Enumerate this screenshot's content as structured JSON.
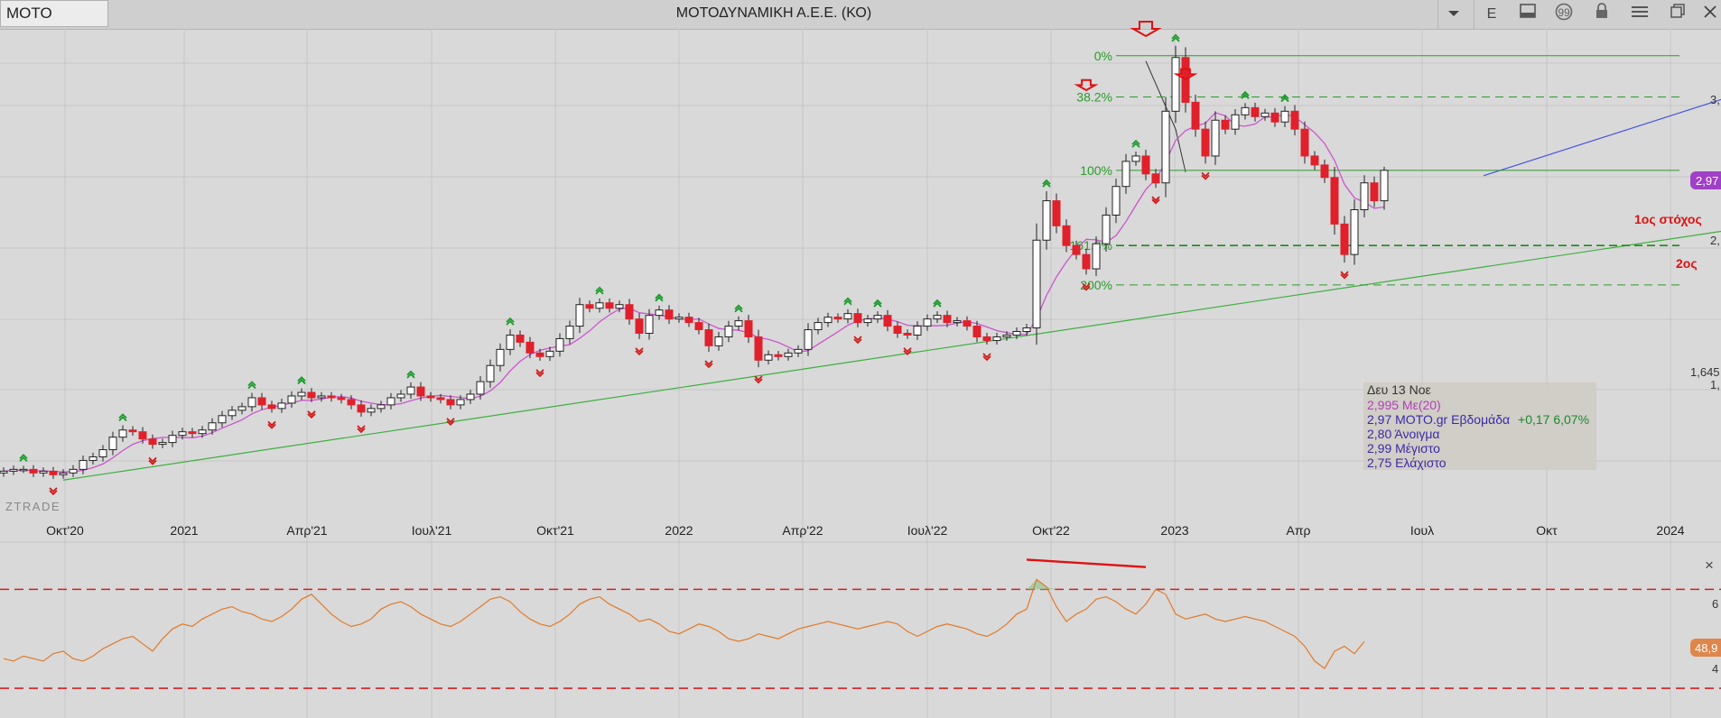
{
  "window": {
    "symbol": "MOTO",
    "title": "ΜΟΤΟΔΥΝΑΜΙΚΗ Α.Ε.Ε. (ΚΟ)",
    "toolbar_letter": "E"
  },
  "price_axis_labels": {
    "a": "3,",
    "b": "2,",
    "c": "1,645",
    "d": "1,",
    "current": "2,97"
  },
  "watermark": "ZTRADE",
  "time_axis": [
    "Οκτ'20",
    "2021",
    "Απρ'21",
    "Ιουλ'21",
    "Οκτ'21",
    "2022",
    "Απρ'22",
    "Ιουλ'22",
    "Οκτ'22",
    "2023",
    "Απρ",
    "Ιουλ",
    "Οκτ",
    "2024"
  ],
  "fib_levels": [
    "0%",
    "38.2%",
    "100%",
    "161.8%",
    "200%"
  ],
  "annotations": {
    "target1": "1ος στόχος",
    "target2": "2ος"
  },
  "info_box": {
    "date": "Δευ 13 Νοε",
    "ma": "2,995 Με(20)",
    "close_prefix": "2,97 MOTO.gr Εβδομάδα",
    "change": "+0,17 6,07%",
    "open": "2,80 Άνοιγμα",
    "high": "2,99 Μέγιστο",
    "low": "2,75 Ελάχιστο"
  },
  "indicator": {
    "value_label": "48,9",
    "axis_a": "6",
    "axis_b": "4",
    "close_symbol": "×"
  },
  "colors": {
    "up": "#ffffff",
    "down": "#e0202a",
    "ma": "#cc55cc",
    "trend": "#3fae3f",
    "resist": "#4455dd",
    "rsi": "#e07a2a",
    "fib": "#2a9a2a",
    "accent": "#e01010"
  },
  "chart_data": {
    "type": "candlestick",
    "title": "ΜΟΤΟΔΥΝΑΜΙΚΗ Α.Ε.Ε. (ΚΟ)",
    "interval": "weekly",
    "close": [
      1.29,
      1.3,
      1.3,
      1.28,
      1.29,
      1.27,
      1.28,
      1.3,
      1.35,
      1.37,
      1.41,
      1.48,
      1.52,
      1.51,
      1.47,
      1.44,
      1.45,
      1.49,
      1.51,
      1.5,
      1.52,
      1.56,
      1.6,
      1.63,
      1.65,
      1.7,
      1.66,
      1.64,
      1.67,
      1.71,
      1.73,
      1.7,
      1.71,
      1.7,
      1.69,
      1.66,
      1.62,
      1.64,
      1.66,
      1.7,
      1.72,
      1.76,
      1.71,
      1.7,
      1.69,
      1.66,
      1.69,
      1.72,
      1.79,
      1.88,
      1.97,
      2.05,
      2.01,
      1.95,
      1.93,
      1.96,
      2.03,
      2.1,
      2.22,
      2.2,
      2.23,
      2.2,
      2.22,
      2.14,
      2.06,
      2.16,
      2.19,
      2.14,
      2.15,
      2.12,
      2.08,
      1.99,
      2.04,
      2.1,
      2.13,
      2.04,
      1.91,
      1.94,
      1.93,
      1.95,
      1.97,
      2.08,
      2.12,
      2.15,
      2.14,
      2.17,
      2.12,
      2.14,
      2.16,
      2.1,
      2.06,
      2.05,
      2.1,
      2.14,
      2.16,
      2.12,
      2.13,
      2.1,
      2.04,
      2.02,
      2.04,
      2.05,
      2.07,
      2.09,
      2.58,
      2.8,
      2.66,
      2.55,
      2.5,
      2.42,
      2.56,
      2.72,
      2.88,
      3.02,
      3.05,
      2.95,
      2.9,
      3.3,
      3.6,
      3.35,
      3.2,
      3.05,
      3.25,
      3.2,
      3.28,
      3.32,
      3.27,
      3.29,
      3.24,
      3.3,
      3.2,
      3.05,
      3.0,
      2.93,
      2.67,
      2.5,
      2.75,
      2.9,
      2.8,
      2.97
    ],
    "ma20_last": 2.995,
    "last": {
      "date": "Δευ 13 Νοε",
      "open": 2.8,
      "high": 2.99,
      "low": 2.75,
      "close": 2.97,
      "change": 0.17,
      "change_pct": 6.07
    },
    "fibonacci": {
      "levels": [
        "0%",
        "38.2%",
        "100%",
        "161.8%",
        "200%"
      ],
      "prices": [
        3.61,
        3.38,
        2.97,
        2.55,
        2.33
      ]
    },
    "trendline_support": {
      "from": [
        6,
        1.24
      ],
      "to": [
        167,
        2.58
      ]
    },
    "trendline_resistance": {
      "from": [
        149,
        2.94
      ],
      "to": [
        167,
        3.26
      ]
    },
    "rsi": [
      42,
      41,
      43,
      42,
      41,
      44,
      45,
      42,
      41,
      43,
      46,
      48,
      50,
      51,
      48,
      45,
      50,
      54,
      56,
      55,
      58,
      60,
      62,
      63,
      61,
      60,
      58,
      57,
      59,
      62,
      66,
      68,
      64,
      60,
      57,
      55,
      56,
      58,
      62,
      64,
      65,
      63,
      60,
      58,
      56,
      55,
      57,
      60,
      63,
      66,
      67,
      65,
      61,
      58,
      56,
      55,
      57,
      60,
      64,
      66,
      67,
      64,
      62,
      60,
      57,
      58,
      56,
      53,
      52,
      54,
      56,
      55,
      53,
      50,
      49,
      50,
      52,
      51,
      50,
      52,
      54,
      55,
      56,
      57,
      56,
      55,
      54,
      55,
      56,
      57,
      56,
      53,
      51,
      53,
      55,
      56,
      55,
      54,
      52,
      51,
      53,
      56,
      60,
      62,
      74,
      71,
      63,
      57,
      60,
      62,
      66,
      67,
      65,
      62,
      60,
      64,
      70,
      68,
      60,
      58,
      59,
      60,
      58,
      57,
      58,
      59,
      58,
      57,
      55,
      53,
      51,
      47,
      41,
      38,
      45,
      47,
      44,
      48.9
    ],
    "rsi_levels": [
      70,
      30
    ]
  }
}
